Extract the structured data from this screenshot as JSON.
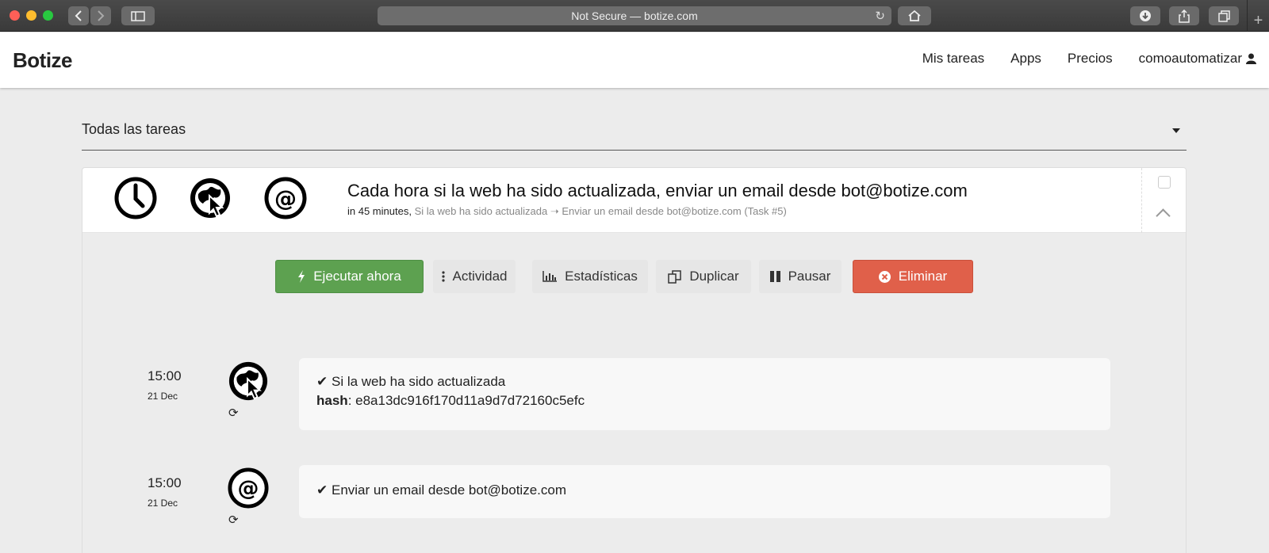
{
  "browser": {
    "address": "Not Secure — botize.com",
    "new_tab": "+"
  },
  "navbar": {
    "brand": "Botize",
    "links": [
      "Mis tareas",
      "Apps",
      "Precios",
      "comoautomatizar"
    ]
  },
  "filter": {
    "label": "Todas las tareas"
  },
  "task": {
    "title": "Cada hora si la web ha sido actualizada, enviar un email desde bot@botize.com",
    "when": "in 45 minutes,",
    "detail": "Si la web ha sido actualizada ➝ Enviar un email desde bot@botize.com (Task #5)",
    "icons": [
      "clock-icon",
      "web-cursor-icon",
      "at-icon"
    ]
  },
  "actions": {
    "run": "Ejecutar ahora",
    "activity": "Actividad",
    "stats": "Estadísticas",
    "duplicate": "Duplicar",
    "pause": "Pausar",
    "delete": "Eliminar",
    "colors": {
      "run": "#5da150",
      "delete": "#e0604a"
    }
  },
  "events": [
    {
      "time": "15:00",
      "date": "21 Dec",
      "icon": "web-cursor-icon",
      "title": "Si la web ha sido actualizada",
      "hash_key": "hash",
      "hash_value": ": e8a13dc916f170d11a9d7d72160c5efc"
    },
    {
      "time": "15:00",
      "date": "21 Dec",
      "icon": "at-icon",
      "title": "Enviar un email desde bot@botize.com"
    }
  ]
}
